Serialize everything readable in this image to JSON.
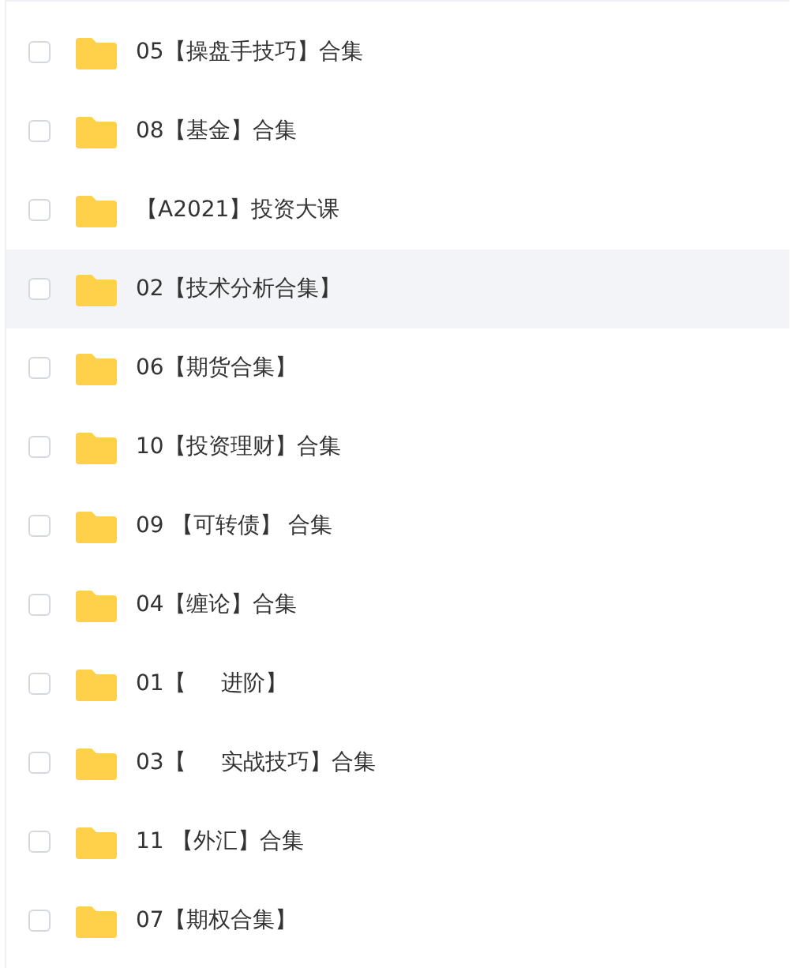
{
  "files": [
    {
      "name_parts": [
        "05【操盘手技巧】合集"
      ],
      "checked": false,
      "highlighted": false
    },
    {
      "name_parts": [
        "08【基金】合集"
      ],
      "checked": false,
      "highlighted": false
    },
    {
      "name_parts": [
        "【A2021】投资大课"
      ],
      "checked": false,
      "highlighted": false
    },
    {
      "name_parts": [
        "02【技术分析合集】"
      ],
      "checked": false,
      "highlighted": true
    },
    {
      "name_parts": [
        "06【期货合集】"
      ],
      "checked": false,
      "highlighted": false
    },
    {
      "name_parts": [
        "10【投资理财】合集"
      ],
      "checked": false,
      "highlighted": false
    },
    {
      "name_parts": [
        "09 【可转债】 合集"
      ],
      "checked": false,
      "highlighted": false
    },
    {
      "name_parts": [
        "04【缠论】合集"
      ],
      "checked": false,
      "highlighted": false
    },
    {
      "name_parts": [
        "01【",
        "进阶】"
      ],
      "checked": false,
      "highlighted": false
    },
    {
      "name_parts": [
        "03【",
        "实战技巧】合集"
      ],
      "checked": false,
      "highlighted": false
    },
    {
      "name_parts": [
        "11 【外汇】合集"
      ],
      "checked": false,
      "highlighted": false
    },
    {
      "name_parts": [
        "07【期权合集】"
      ],
      "checked": false,
      "highlighted": false
    }
  ]
}
